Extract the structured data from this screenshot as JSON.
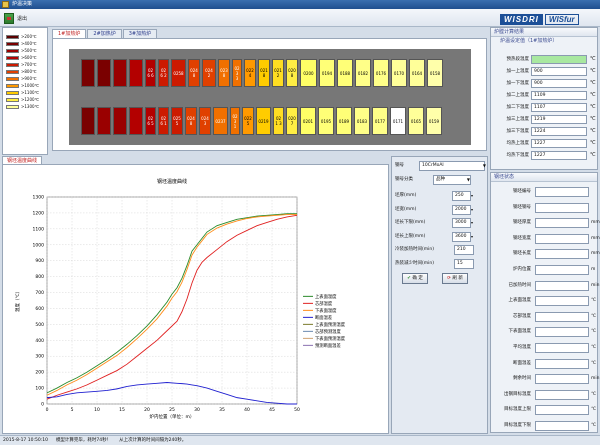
{
  "window": {
    "title": "炉温决策"
  },
  "toolbar": {
    "exit_label": "退出"
  },
  "logo": {
    "part1": "WISDRI",
    "part2": "WISfur"
  },
  "furnace_tabs": [
    "1#加热炉",
    "2#加热炉",
    "3#加热炉"
  ],
  "legend": [
    {
      "label": ">200℃",
      "color": "#5a0000"
    },
    {
      "label": ">400℃",
      "color": "#7a0000"
    },
    {
      "label": ">500℃",
      "color": "#9a0000"
    },
    {
      "label": ">600℃",
      "color": "#b30000"
    },
    {
      "label": ">700℃",
      "color": "#cc1a00"
    },
    {
      "label": ">800℃",
      "color": "#e04000"
    },
    {
      "label": ">900℃",
      "color": "#f07000"
    },
    {
      "label": ">1000℃",
      "color": "#ff9900"
    },
    {
      "label": ">1100℃",
      "color": "#ffcc00"
    },
    {
      "label": ">1200℃",
      "color": "#ffee44"
    },
    {
      "label": ">1300℃",
      "color": "#ffff99"
    }
  ],
  "furnace": {
    "top_row": [
      {
        "label": "",
        "color": "#7a0000",
        "w": 14,
        "h": 28
      },
      {
        "label": "",
        "color": "#7a0000",
        "w": 14,
        "h": 28
      },
      {
        "label": "",
        "color": "#9a0000",
        "w": 14,
        "h": 28
      },
      {
        "label": "",
        "color": "#b30000",
        "w": 14,
        "h": 28
      },
      {
        "label": "026 6",
        "color": "#b30000",
        "w": 11,
        "h": 28
      },
      {
        "label": "026 2",
        "color": "#cc1a00",
        "w": 11,
        "h": 28
      },
      {
        "label": "0258",
        "color": "#cc1a00",
        "w": 15,
        "h": 28
      },
      {
        "label": "024 8",
        "color": "#e04000",
        "w": 12,
        "h": 28
      },
      {
        "label": "0242",
        "color": "#e04000",
        "w": 14,
        "h": 28
      },
      {
        "label": "023 8",
        "color": "#f07000",
        "w": 12,
        "h": 28
      },
      {
        "label": "023 3",
        "color": "#f07000",
        "w": 10,
        "h": 28
      },
      {
        "label": "022 4",
        "color": "#ff9900",
        "w": 12,
        "h": 28
      },
      {
        "label": "021 8",
        "color": "#ffcc00",
        "w": 12,
        "h": 28
      },
      {
        "label": "021 2",
        "color": "#ffdd22",
        "w": 12,
        "h": 28
      },
      {
        "label": "020 8",
        "color": "#ffee44",
        "w": 12,
        "h": 28
      },
      {
        "label": "0200",
        "color": "#ffff66",
        "w": 17,
        "h": 28
      },
      {
        "label": "0194",
        "color": "#ffff77",
        "w": 16,
        "h": 28
      },
      {
        "label": "0188",
        "color": "#ffff77",
        "w": 16,
        "h": 28
      },
      {
        "label": "0182",
        "color": "#ffff88",
        "w": 16,
        "h": 28
      },
      {
        "label": "0176",
        "color": "#ffff88",
        "w": 16,
        "h": 28
      },
      {
        "label": "0170",
        "color": "#ffff99",
        "w": 16,
        "h": 28
      },
      {
        "label": "0164",
        "color": "#ffff99",
        "w": 16,
        "h": 28
      },
      {
        "label": "0158",
        "color": "#ffffaa",
        "w": 16,
        "h": 28
      }
    ],
    "bottom_row": [
      {
        "label": "",
        "color": "#7a0000",
        "w": 14,
        "h": 28
      },
      {
        "label": "",
        "color": "#9a0000",
        "w": 14,
        "h": 28
      },
      {
        "label": "",
        "color": "#9a0000",
        "w": 14,
        "h": 28
      },
      {
        "label": "",
        "color": "#b30000",
        "w": 14,
        "h": 28
      },
      {
        "label": "026 5",
        "color": "#b30000",
        "w": 11,
        "h": 28
      },
      {
        "label": "026 1",
        "color": "#cc1a00",
        "w": 11,
        "h": 28
      },
      {
        "label": "025 5",
        "color": "#cc1a00",
        "w": 12,
        "h": 28
      },
      {
        "label": "024 8",
        "color": "#e04000",
        "w": 12,
        "h": 28
      },
      {
        "label": "024 3",
        "color": "#e04000",
        "w": 12,
        "h": 28
      },
      {
        "label": "0237",
        "color": "#f07000",
        "w": 15,
        "h": 28
      },
      {
        "label": "023 1",
        "color": "#f07000",
        "w": 10,
        "h": 28
      },
      {
        "label": "022 5",
        "color": "#ff9900",
        "w": 12,
        "h": 28
      },
      {
        "label": "0219",
        "color": "#ffcc00",
        "w": 15,
        "h": 28
      },
      {
        "label": "021 3",
        "color": "#ffdd22",
        "w": 11,
        "h": 28
      },
      {
        "label": "020 7",
        "color": "#ffee44",
        "w": 12,
        "h": 28
      },
      {
        "label": "0201",
        "color": "#ffff66",
        "w": 16,
        "h": 28
      },
      {
        "label": "0195",
        "color": "#ffff77",
        "w": 16,
        "h": 28
      },
      {
        "label": "0189",
        "color": "#ffff77",
        "w": 16,
        "h": 28
      },
      {
        "label": "0183",
        "color": "#ffff88",
        "w": 16,
        "h": 28
      },
      {
        "label": "0177",
        "color": "#ffff88",
        "w": 16,
        "h": 28
      },
      {
        "label": "0171",
        "color": "#ffffff",
        "w": 16,
        "h": 28
      },
      {
        "label": "0165",
        "color": "#ffff99",
        "w": 16,
        "h": 28
      },
      {
        "label": "0159",
        "color": "#ffffaa",
        "w": 16,
        "h": 28
      }
    ]
  },
  "furnace_calc": {
    "title": "炉膛计算结果",
    "subtitle": "炉温设定值（1#加热炉）",
    "rows": [
      {
        "label": "预热段温度",
        "value": "",
        "unit": "℃",
        "highlight": true
      },
      {
        "label": "加一上温度",
        "value": "900",
        "unit": "℃"
      },
      {
        "label": "加一下温度",
        "value": "900",
        "unit": "℃"
      },
      {
        "label": "加二上温度",
        "value": "1109",
        "unit": "℃"
      },
      {
        "label": "加二下温度",
        "value": "1107",
        "unit": "℃"
      },
      {
        "label": "加三上温度",
        "value": "1219",
        "unit": "℃"
      },
      {
        "label": "加三下温度",
        "value": "1224",
        "unit": "℃"
      },
      {
        "label": "均热上温度",
        "value": "1227",
        "unit": "℃"
      },
      {
        "label": "均热下温度",
        "value": "1227",
        "unit": "℃"
      }
    ]
  },
  "slab_status": {
    "title": "钢坯状态",
    "rows": [
      {
        "label": "钢坯编号",
        "unit": ""
      },
      {
        "label": "钢坯钢号",
        "unit": ""
      },
      {
        "label": "钢坯厚度",
        "unit": "mm"
      },
      {
        "label": "钢坯宽度",
        "unit": "mm"
      },
      {
        "label": "钢坯长度",
        "unit": "mm"
      },
      {
        "label": "炉内位置",
        "unit": "m"
      },
      {
        "label": "已加热时间",
        "unit": "min"
      },
      {
        "label": "上表面温度",
        "unit": "℃"
      },
      {
        "label": "芯部温度",
        "unit": "℃"
      },
      {
        "label": "下表面温度",
        "unit": "℃"
      },
      {
        "label": "平均温度",
        "unit": "℃"
      },
      {
        "label": "断面温差",
        "unit": "℃"
      },
      {
        "label": "剩余时间",
        "unit": "min"
      },
      {
        "label": "出钢目标温度",
        "unit": "℃"
      },
      {
        "label": "目标温度上限",
        "unit": "℃"
      },
      {
        "label": "目标温度下限",
        "unit": "℃"
      }
    ]
  },
  "chart_tab": "钢坯温度曲线",
  "params": {
    "steel_label": "钢号",
    "steel_value": "10CrMoAl",
    "class_label": "钢号分类",
    "class_value": "品种",
    "rows": [
      {
        "label": "坯厚(mm)",
        "value": "250"
      },
      {
        "label": "坯宽(mm)",
        "value": "2000"
      },
      {
        "label": "坯长下限(mm)",
        "value": "3000"
      },
      {
        "label": "坯长上限(mm)",
        "value": "3600"
      },
      {
        "label": "冷装加热时间(min)",
        "value": "210"
      },
      {
        "label": "热装减少时间(min)",
        "value": "15"
      }
    ],
    "confirm": "确 定",
    "refresh": "刷 新"
  },
  "status_bar": {
    "time": "2015-8-17 10:50:10",
    "msg1": "模型计算完毕，耗时74秒！",
    "msg2": "从上次计算的时间间隔为240秒。"
  },
  "chart_data": {
    "type": "line",
    "title": "钢坯温度曲线",
    "xlabel": "炉内位置（单位：m）",
    "ylabel": "温度（℃）",
    "xlim": [
      0,
      50
    ],
    "ylim": [
      0,
      1300
    ],
    "xticks": [
      0,
      5,
      10,
      15,
      20,
      25,
      30,
      35,
      40,
      45,
      50
    ],
    "yticks": [
      0,
      100,
      200,
      300,
      400,
      500,
      600,
      700,
      800,
      900,
      1000,
      1100,
      1200,
      1300
    ],
    "grid": true,
    "legend_position": "right",
    "series": [
      {
        "name": "上表面温度",
        "color": "#2a8a2a",
        "x": [
          0,
          2,
          4,
          6,
          8,
          10,
          12,
          14,
          16,
          18,
          20,
          22,
          24,
          25,
          26,
          27,
          28,
          29,
          30,
          31,
          32,
          34,
          36,
          38,
          40,
          42,
          44,
          46,
          48,
          50
        ],
        "y": [
          70,
          100,
          135,
          165,
          200,
          240,
          280,
          325,
          375,
          430,
          490,
          560,
          640,
          690,
          730,
          790,
          870,
          960,
          1000,
          1040,
          1080,
          1120,
          1140,
          1160,
          1170,
          1180,
          1185,
          1190,
          1195,
          1195
        ]
      },
      {
        "name": "芯部温度",
        "color": "#e02020",
        "x": [
          0,
          2,
          4,
          6,
          8,
          10,
          12,
          14,
          16,
          18,
          20,
          22,
          24,
          26,
          27,
          28,
          29,
          30,
          31,
          32,
          34,
          36,
          38,
          40,
          42,
          44,
          46,
          48,
          50
        ],
        "y": [
          30,
          55,
          75,
          95,
          120,
          150,
          180,
          210,
          250,
          300,
          350,
          400,
          460,
          520,
          580,
          660,
          760,
          840,
          890,
          920,
          970,
          1020,
          1060,
          1090,
          1120,
          1140,
          1160,
          1175,
          1185
        ]
      },
      {
        "name": "下表面温度",
        "color": "#ff8c1a",
        "x": [
          0,
          2,
          4,
          6,
          8,
          10,
          12,
          14,
          16,
          18,
          20,
          22,
          24,
          25,
          26,
          27,
          28,
          29,
          30,
          31,
          32,
          34,
          36,
          38,
          40,
          42,
          44,
          46,
          48,
          50
        ],
        "y": [
          55,
          85,
          120,
          150,
          185,
          225,
          265,
          305,
          355,
          410,
          470,
          535,
          615,
          665,
          705,
          765,
          845,
          935,
          985,
          1025,
          1065,
          1105,
          1130,
          1150,
          1165,
          1175,
          1180,
          1185,
          1190,
          1190
        ]
      },
      {
        "name": "断面温差",
        "color": "#2020d0",
        "x": [
          0,
          2,
          4,
          6,
          8,
          10,
          12,
          14,
          16,
          18,
          20,
          22,
          24,
          26,
          27,
          28,
          29,
          30,
          32,
          34,
          36,
          38,
          40,
          42,
          44,
          46,
          48,
          50
        ],
        "y": [
          40,
          45,
          60,
          70,
          75,
          80,
          85,
          95,
          110,
          120,
          125,
          130,
          135,
          130,
          128,
          125,
          120,
          115,
          100,
          80,
          60,
          40,
          30,
          20,
          10,
          5,
          0,
          0
        ]
      },
      {
        "name": "上表面预测温度",
        "color": "#7a7a2a",
        "x": [],
        "y": []
      },
      {
        "name": "芯部预测温度",
        "color": "#6a8ab0",
        "x": [],
        "y": []
      },
      {
        "name": "下表面预测温度",
        "color": "#d0a070",
        "x": [],
        "y": []
      },
      {
        "name": "预测断面温差",
        "color": "#8a70b0",
        "x": [],
        "y": []
      }
    ]
  }
}
